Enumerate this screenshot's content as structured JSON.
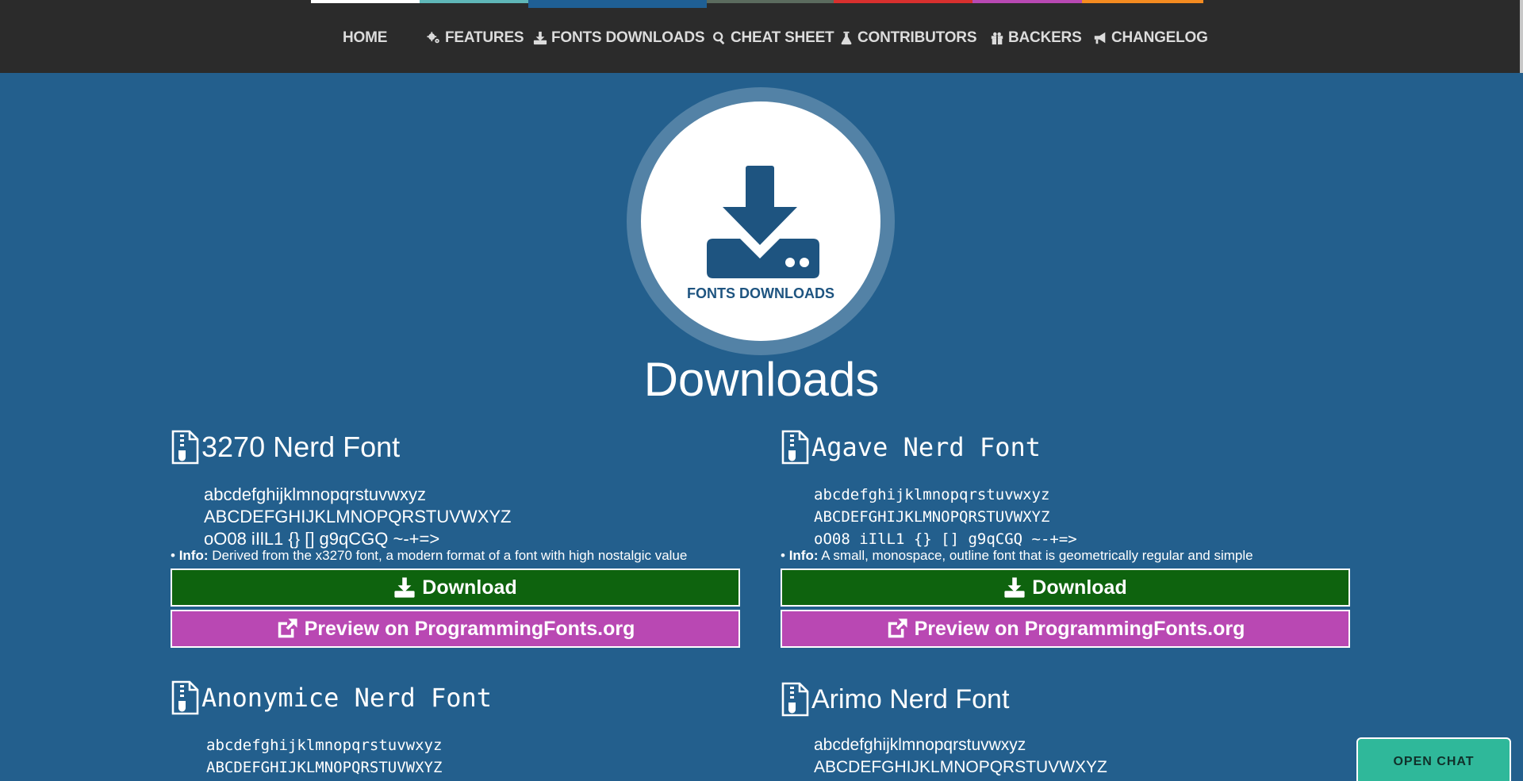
{
  "nav": {
    "stripe_colors": [
      "#ffffff",
      "#5fb7b8",
      "#1f5f94",
      "#5b6b5e",
      "#d8302e",
      "#b849b3",
      "#f58b20"
    ],
    "items": [
      {
        "label": "HOME",
        "icon": ""
      },
      {
        "label": "FEATURES",
        "icon": "gears-icon"
      },
      {
        "label": "FONTS DOWNLOADS",
        "icon": "download-icon"
      },
      {
        "label": "CHEAT SHEET",
        "icon": "search-icon"
      },
      {
        "label": "CONTRIBUTORS",
        "icon": "flask-icon"
      },
      {
        "label": "BACKERS",
        "icon": "gift-icon"
      },
      {
        "label": "CHANGELOG",
        "icon": "bullhorn-icon"
      }
    ]
  },
  "hero": {
    "label": "FONTS DOWNLOADS",
    "icon": "download-tray-icon"
  },
  "page_title": "Downloads",
  "fonts": [
    {
      "name": "3270 Nerd Font",
      "sample_lower": "abcdefghijklmnopqrstuvwxyz",
      "sample_upper": "ABCDEFGHIJKLMNOPQRSTUVWXYZ",
      "sample_symbols": "oO08 iIlL1 {} [] g9qCGQ ~-+=>",
      "info_label": "Info:",
      "info_text": " Derived from the x3270 font, a modern format of a font with high nostalgic value",
      "download_label": "Download",
      "preview_label": "Preview on ProgrammingFonts.org"
    },
    {
      "name": "Agave Nerd Font",
      "sample_lower": "abcdefghijklmnopqrstuvwxyz",
      "sample_upper": "ABCDEFGHIJKLMNOPQRSTUVWXYZ",
      "sample_symbols": "oO08 iIlL1 {} [] g9qCGQ ~-+=>",
      "info_label": "Info:",
      "info_text": " A small, monospace, outline font that is geometrically regular and simple",
      "download_label": "Download",
      "preview_label": "Preview on ProgrammingFonts.org"
    },
    {
      "name": "Anonymice Nerd Font",
      "sample_lower": "abcdefghijklmnopqrstuvwxyz",
      "sample_upper": "ABCDEFGHIJKLMNOPQRSTUVWXYZ"
    },
    {
      "name": "Arimo Nerd Font",
      "sample_lower": "abcdefghijklmnopqrstuvwxyz",
      "sample_upper": "ABCDEFGHIJKLMNOPQRSTUVWXYZ"
    }
  ],
  "chat": {
    "label": "OPEN CHAT"
  },
  "colors": {
    "background": "#235f8d",
    "topbar": "#2b2b2b",
    "download_button": "#0e630e",
    "preview_button": "#b948b3",
    "chat_button": "#2fb89a"
  }
}
